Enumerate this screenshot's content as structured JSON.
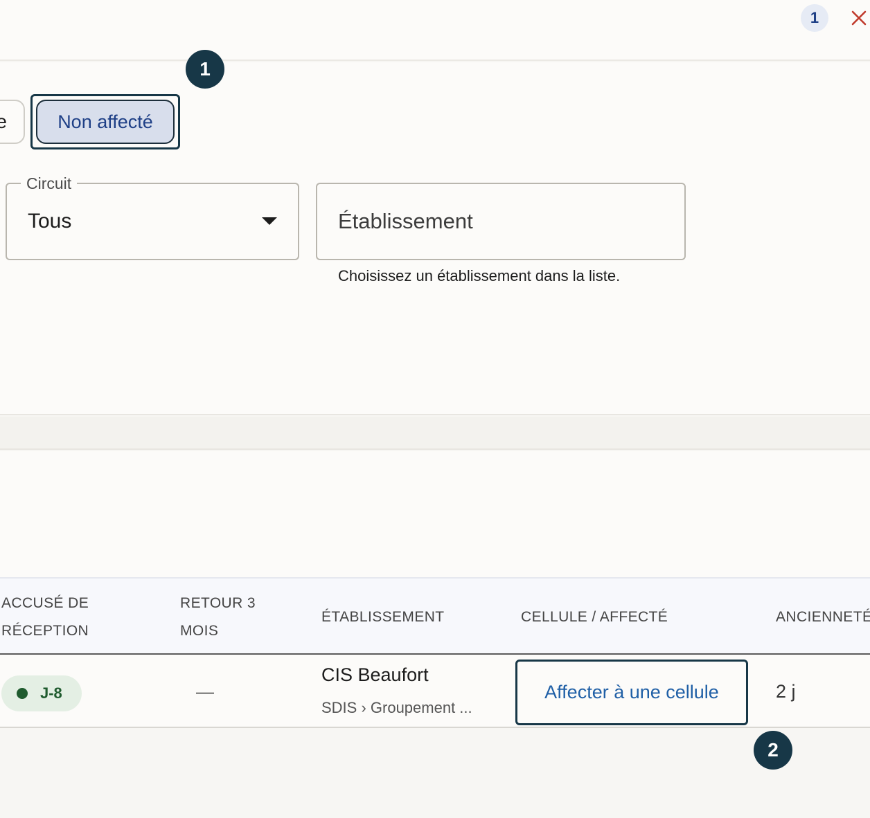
{
  "header": {
    "count_badge": "1",
    "close_icon": "close-x-icon",
    "close_color": "#c0392b"
  },
  "filters": {
    "chips": [
      {
        "label": "e",
        "selected": false
      },
      {
        "label": "Non affecté",
        "selected": true
      }
    ],
    "circuit": {
      "label": "Circuit",
      "value": "Tous"
    },
    "etablissement": {
      "placeholder": "Établissement",
      "helper": "Choisissez un établissement dans la liste."
    }
  },
  "markers": [
    "1",
    "2"
  ],
  "table": {
    "columns": [
      [
        "ACCUSÉ DE",
        "RÉCEPTION"
      ],
      [
        "RETOUR 3",
        "MOIS"
      ],
      [
        "ÉTABLISSEMENT"
      ],
      [
        "CELLULE / AFFECTÉ"
      ],
      [
        "ANCIENNETÉ"
      ]
    ],
    "rows": [
      {
        "accuse": "J-8",
        "retour": "—",
        "etablissement": "CIS Beaufort",
        "etablissement_path": "SDIS › Groupement ...",
        "action": "Affecter à une cellule",
        "anciennete": "2 j"
      }
    ]
  },
  "colors": {
    "accent": "#1e3f86",
    "marker": "#173747",
    "status_green": "#1f5b2e",
    "link_blue": "#1f5fa6"
  }
}
